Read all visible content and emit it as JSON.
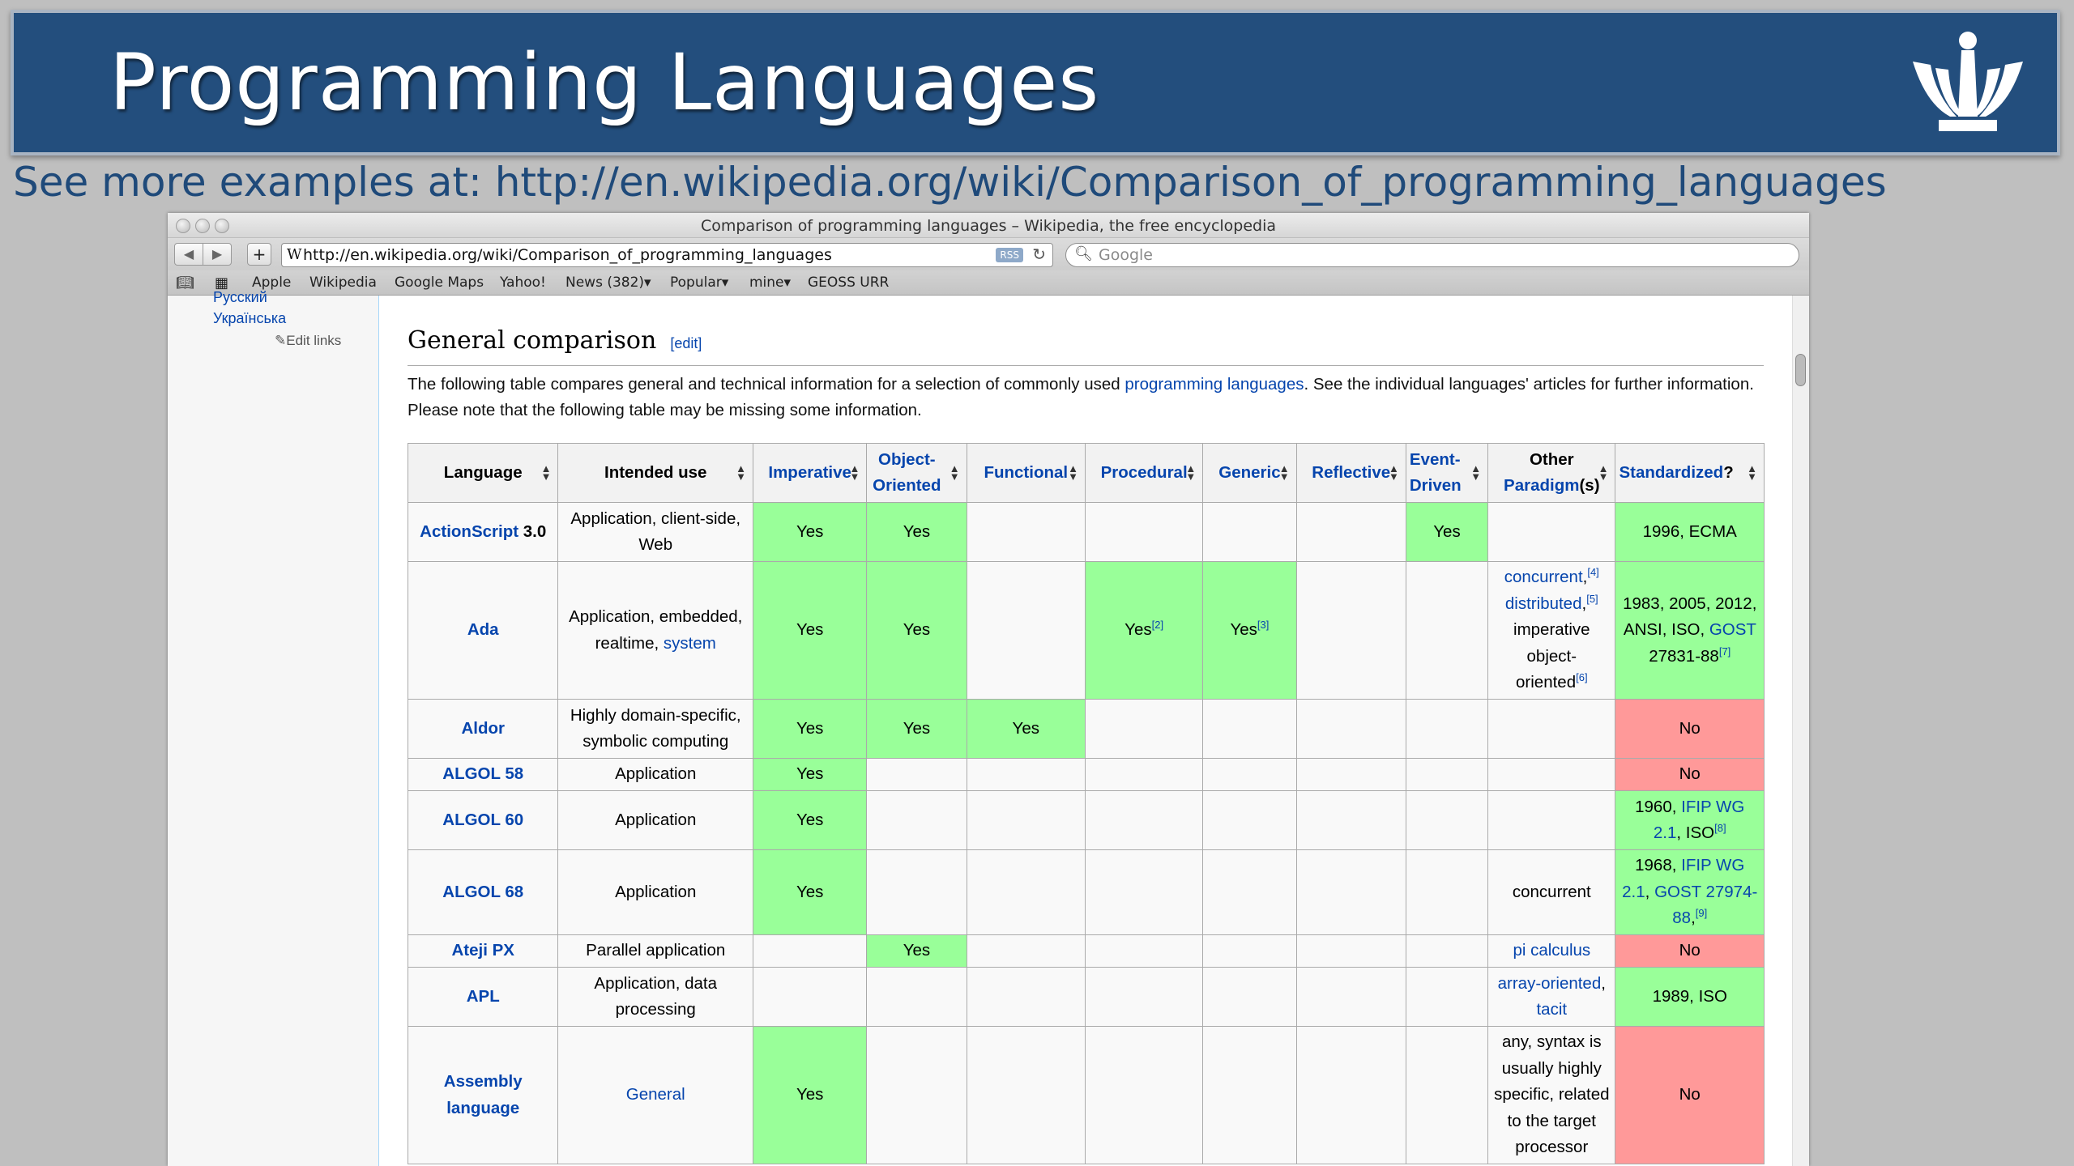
{
  "slide": {
    "title": "Programming Languages",
    "subtitle": "See more examples at: http://en.wikipedia.org/wiki/Comparison_of_programming_languages"
  },
  "browser": {
    "window_title": "Comparison of programming languages – Wikipedia, the free encyclopedia",
    "url": "http://en.wikipedia.org/wiki/Comparison_of_programming_languages",
    "rss_label": "RSS",
    "search_placeholder": "Google",
    "bookmarks": [
      "Apple",
      "Wikipedia",
      "Google Maps",
      "Yahoo!",
      "News (382)▾",
      "Popular▾",
      "mine▾",
      "GEOSS URR"
    ]
  },
  "sidebar": {
    "languages": [
      "Русский",
      "Українська"
    ],
    "edit_links": "Edit links"
  },
  "section": {
    "title": "General comparison",
    "edit": "[edit]",
    "intro_before": "The following table compares general and technical information for a selection of commonly used ",
    "intro_link": "programming languages",
    "intro_after": ". See the individual languages' articles for further information. Please note that the following table may be missing some information."
  },
  "table": {
    "headers": {
      "language": "Language",
      "intended_use": "Intended use",
      "imperative": "Imperative",
      "object_oriented": "Object-Oriented",
      "functional": "Functional",
      "procedural": "Procedural",
      "generic": "Generic",
      "reflective": "Reflective",
      "event_driven": "Event-Driven",
      "other_a": "Other",
      "other_b": "Paradigm",
      "other_c": "(s)",
      "standardized": "Standardized",
      "standardized_q": "?"
    },
    "yes": "Yes",
    "no": "No",
    "rows": {
      "actionscript": {
        "name_link": "ActionScript",
        "name_rest": " 3.0",
        "use": "Application, client-side, Web",
        "std": "1996, ECMA"
      },
      "ada": {
        "name": "Ada",
        "use_text": "Application, embedded, realtime, ",
        "use_link": "system",
        "proc_ref": "[2]",
        "gen_ref": "[3]",
        "other_1": "concurrent",
        "other_1_ref": "[4]",
        "other_2": "distributed",
        "other_2_ref": "[5]",
        "other_3": "imperative object-oriented",
        "other_3_ref": "[6]",
        "std_text": "1983, 2005, 2012, ANSI, ISO, ",
        "std_link": "GOST",
        "std_text2": " 27831-88",
        "std_ref": "[7]"
      },
      "aldor": {
        "name": "Aldor",
        "use": "Highly domain-specific, symbolic computing"
      },
      "algol58": {
        "name": "ALGOL 58",
        "use": "Application"
      },
      "algol60": {
        "name": "ALGOL 60",
        "use": "Application",
        "std_text": "1960, ",
        "std_link": "IFIP WG 2.1",
        "std_text2": ", ISO",
        "std_ref": "[8]"
      },
      "algol68": {
        "name": "ALGOL 68",
        "use": "Application",
        "other": "concurrent",
        "std_text": "1968, ",
        "std_link1": "IFIP WG 2.1",
        "std_sep": ", ",
        "std_link2": "GOST 27974-88",
        "std_text2": ",",
        "std_ref": "[9]"
      },
      "ateji": {
        "name": "Ateji PX",
        "use": "Parallel application",
        "other": "pi calculus"
      },
      "apl": {
        "name": "APL",
        "use": "Application, data processing",
        "other_1": "array-oriented",
        "other_2": "tacit",
        "std": "1989, ISO"
      },
      "assembly": {
        "name": "Assembly language",
        "use": "General",
        "other": "any, syntax is usually highly specific, related to the target processor"
      }
    }
  },
  "colors": {
    "yes_bg": "#99ff99",
    "no_bg": "#ff9999",
    "slide_header": "#234e7d",
    "link": "#0645ad"
  }
}
